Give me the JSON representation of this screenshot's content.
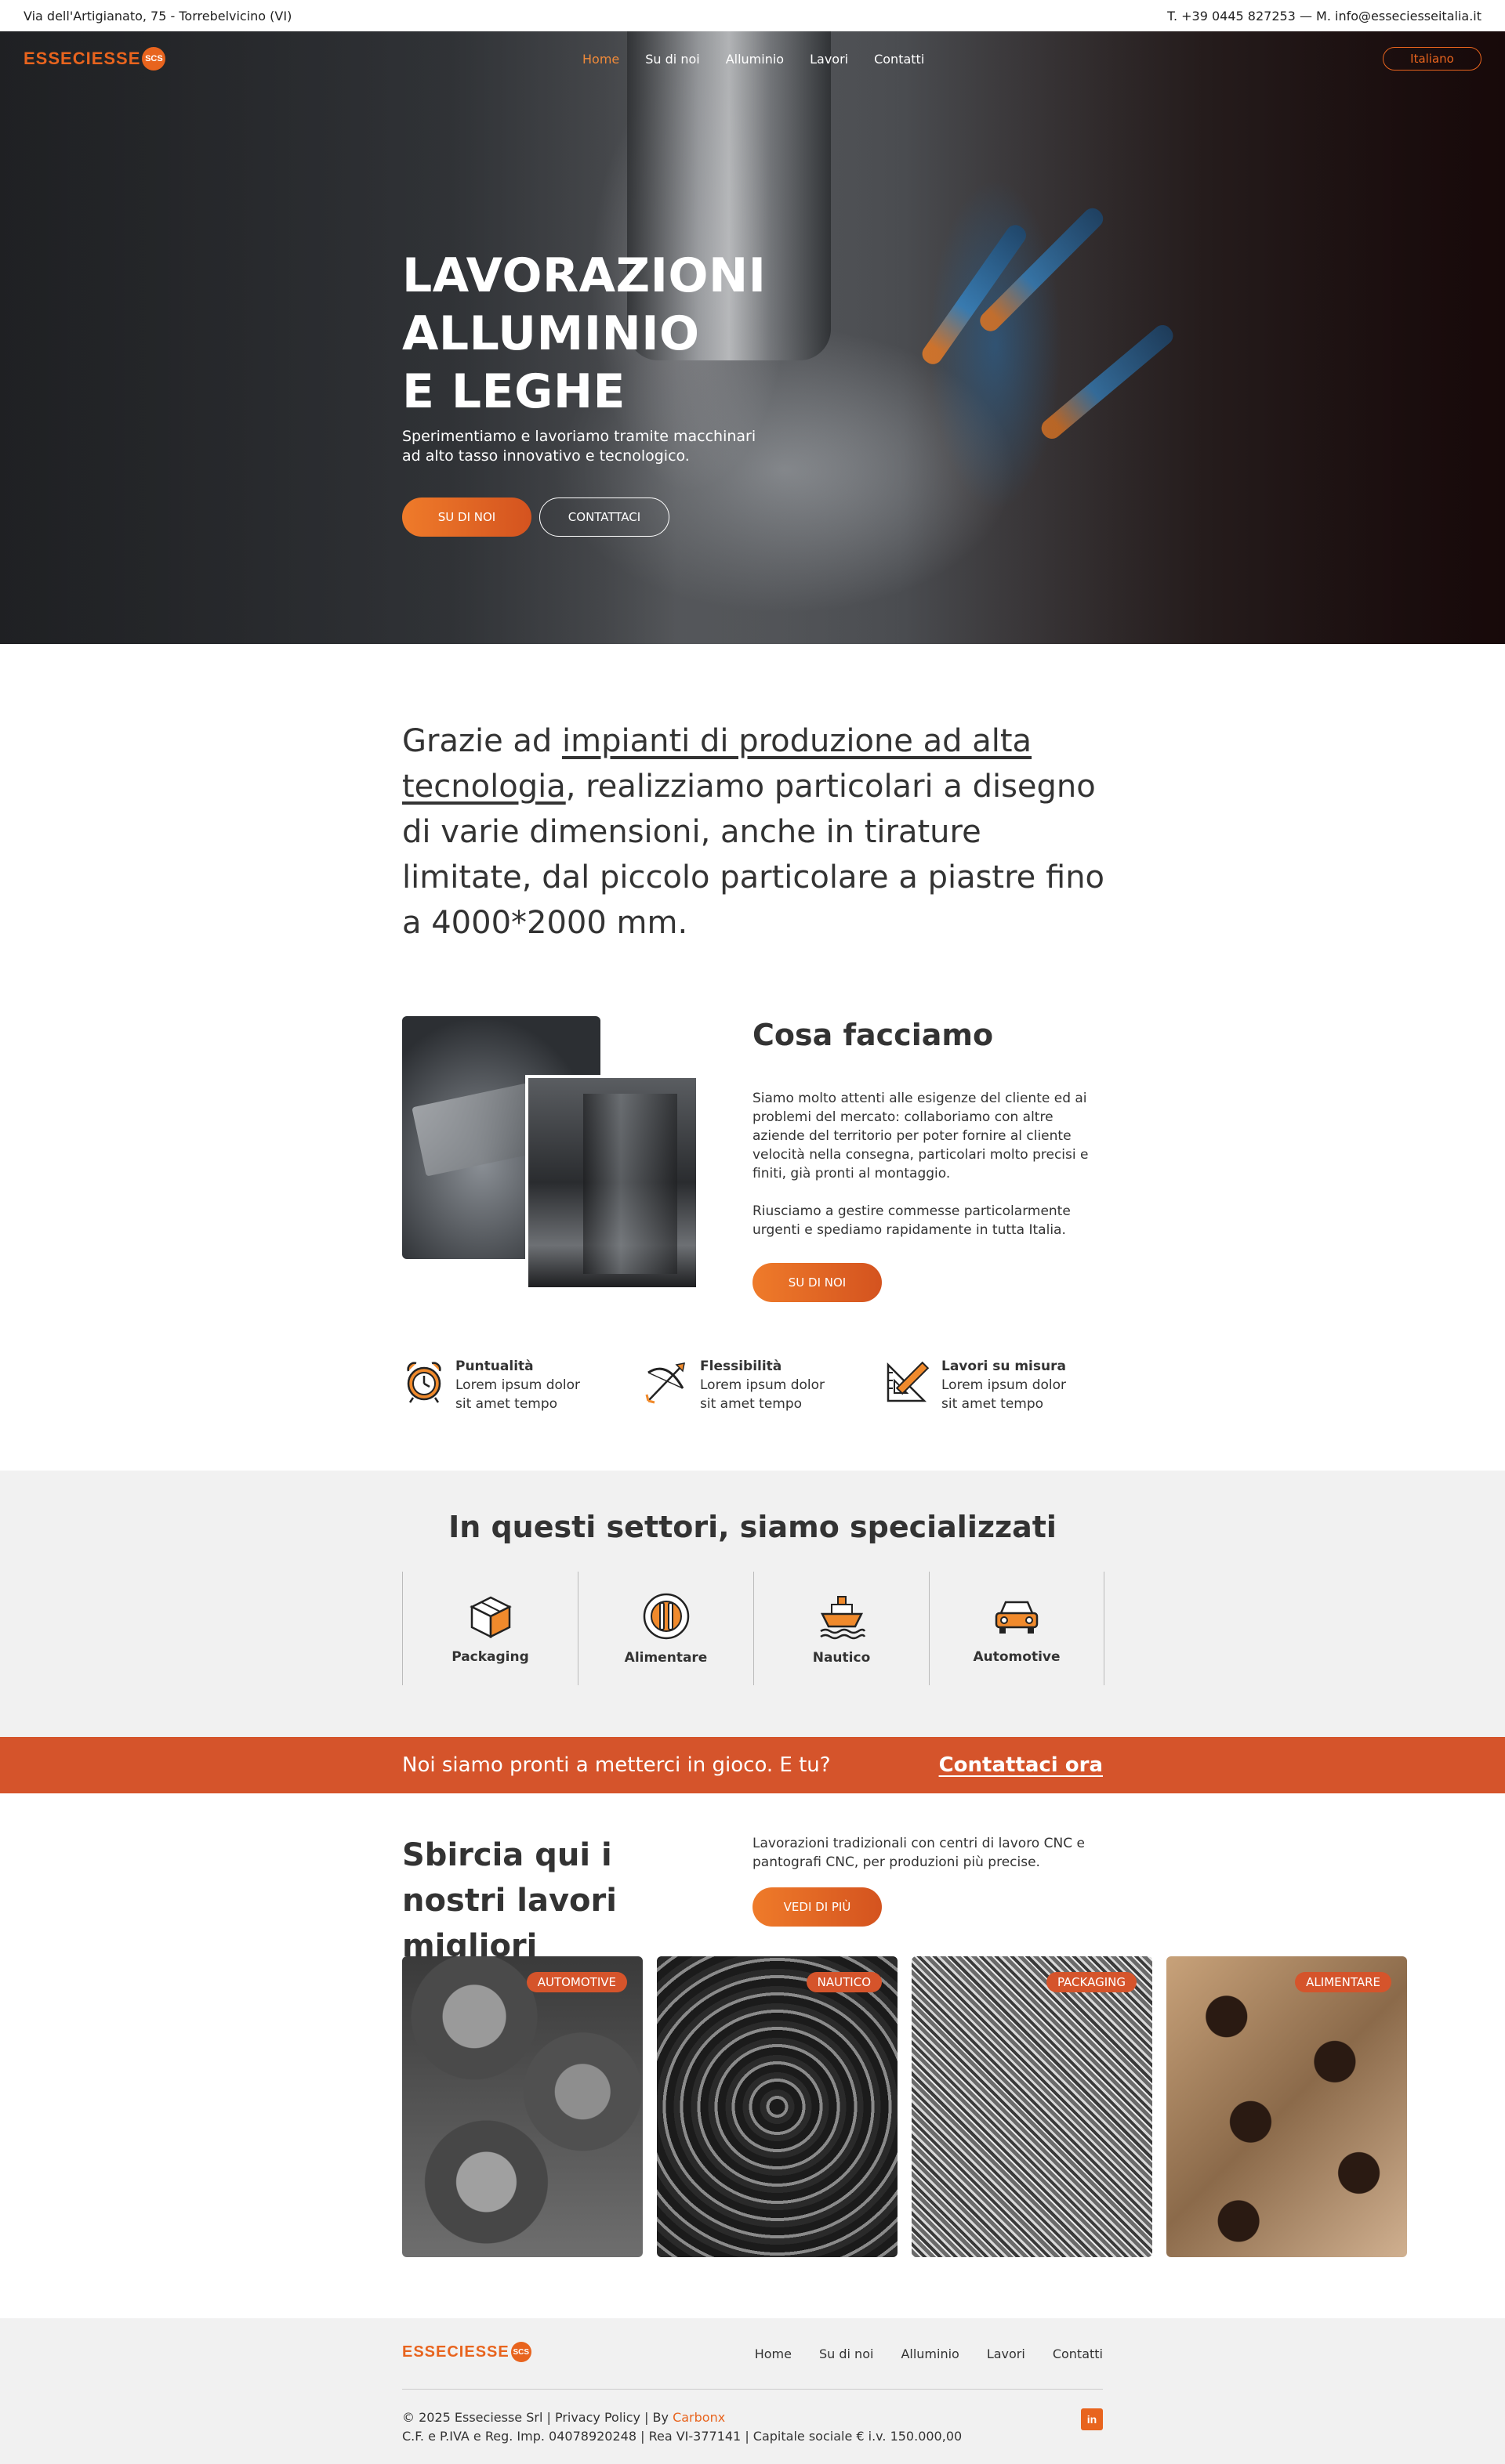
{
  "topbar": {
    "address": "Via dell'Artigianato, 75 - Torrebelvicino (VI)",
    "contacts": "T. +39 0445 827253 — M. info@esseciesseitalia.it"
  },
  "brand": {
    "logo_text": "ESSECIESSE",
    "logo_badge": "SCS",
    "accent": "#e8641e",
    "cta_color": "#d5542b"
  },
  "nav": {
    "items": [
      {
        "label": "Home",
        "active": true
      },
      {
        "label": "Su di noi"
      },
      {
        "label": "Alluminio"
      },
      {
        "label": "Lavori"
      },
      {
        "label": "Contatti"
      }
    ],
    "language": "Italiano"
  },
  "hero": {
    "title_lines": [
      "LAVORAZIONI",
      "ALLUMINIO",
      "E LEGHE"
    ],
    "subtitle": "Sperimentiamo e lavoriamo tramite macchinari ad alto tasso innovativo e tecnologico.",
    "btn_primary": "SU DI NOI",
    "btn_secondary": "CONTATTACI"
  },
  "intro": {
    "before": "Grazie ad ",
    "highlight": "impianti di produzione ad alta tecnologia",
    "after": ", realizziamo particolari a disegno di varie dimensioni, anche in tirature limitate, dal piccolo particolare a piastre fino a 4000*2000 mm."
  },
  "what": {
    "title": "Cosa facciamo",
    "p1": "Siamo molto attenti alle esigenze del cliente ed ai problemi del mercato: collaboriamo con altre aziende del territorio per poter fornire al cliente velocità nella consegna, particolari molto precisi e finiti, già pronti al montaggio.",
    "p2": "Riusciamo a gestire commesse particolarmente urgenti e spediamo rapidamente in tutta Italia.",
    "btn": "SU DI NOI"
  },
  "features": [
    {
      "title": "Puntualità",
      "text": "Lorem ipsum dolor sit amet tempo",
      "icon": "alarm-clock-icon"
    },
    {
      "title": "Flessibilità",
      "text": "Lorem ipsum dolor sit amet tempo",
      "icon": "bow-arrow-icon"
    },
    {
      "title": "Lavori su misura",
      "text": "Lorem ipsum dolor sit amet tempo",
      "icon": "ruler-pencil-icon"
    }
  ],
  "sectors": {
    "title": "In questi settori, siamo specializzati",
    "items": [
      {
        "label": "Packaging",
        "icon": "package-box-icon"
      },
      {
        "label": "Alimentare",
        "icon": "cutlery-plate-icon"
      },
      {
        "label": "Nautico",
        "icon": "ship-icon"
      },
      {
        "label": "Automotive",
        "icon": "car-icon"
      }
    ]
  },
  "cta": {
    "text": "Noi siamo pronti a metterci in gioco. E tu?",
    "link": "Contattaci ora"
  },
  "works": {
    "title": "Sbircia qui i nostri lavori migliori",
    "text": "Lavorazioni tradizionali con centri di lavoro CNC e pantografi CNC, per produzioni più precise.",
    "btn": "VEDI DI PIÙ",
    "cards": [
      {
        "tag": "AUTOMOTIVE"
      },
      {
        "tag": "NAUTICO"
      },
      {
        "tag": "PACKAGING"
      },
      {
        "tag": "ALIMENTARE"
      }
    ]
  },
  "footer": {
    "menu": [
      "Home",
      "Su di noi",
      "Alluminio",
      "Lavori",
      "Contatti"
    ],
    "copy_prefix": "© 2025 Esseciesse Srl | Privacy Policy | By ",
    "copy_brand": "Carbonx",
    "legal": "C.F. e P.IVA e Reg. Imp. 04078920248 | Rea VI-377141 | Capitale sociale € i.v. 150.000,00",
    "social": "in"
  }
}
